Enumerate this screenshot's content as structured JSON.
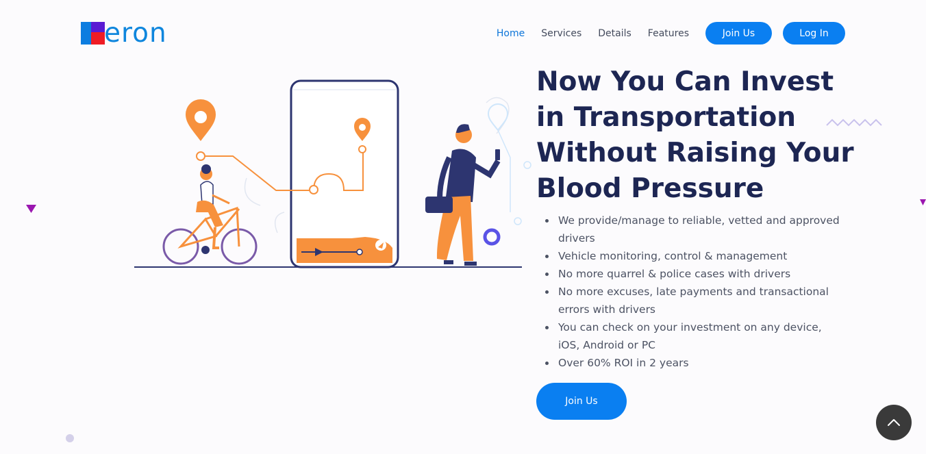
{
  "header": {
    "logo_text": "eron",
    "nav": {
      "home": "Home",
      "services": "Services",
      "details": "Details",
      "features": "Features"
    },
    "join_label": "Join Us",
    "login_label": "Log In"
  },
  "hero": {
    "title": "Now You Can Invest in Transportation Without Raising Your Blood Pressure",
    "bullets": [
      "We provide/manage to reliable, vetted and approved drivers",
      "Vehicle monitoring, control & management",
      "No more quarrel & police cases with drivers",
      "No more excuses, late payments and transactional errors with drivers",
      "You can check on your investment on any device, iOS, Android or PC",
      "Over 60% ROI in 2 years"
    ],
    "cta_label": "Join Us"
  },
  "icons": {
    "back_to_top": "chevron-up-icon"
  },
  "colors": {
    "brand_blue": "#0a7ff1",
    "heading_navy": "#1d2653",
    "illustration_orange": "#f7913d",
    "accent_purple": "#9b17b0"
  }
}
